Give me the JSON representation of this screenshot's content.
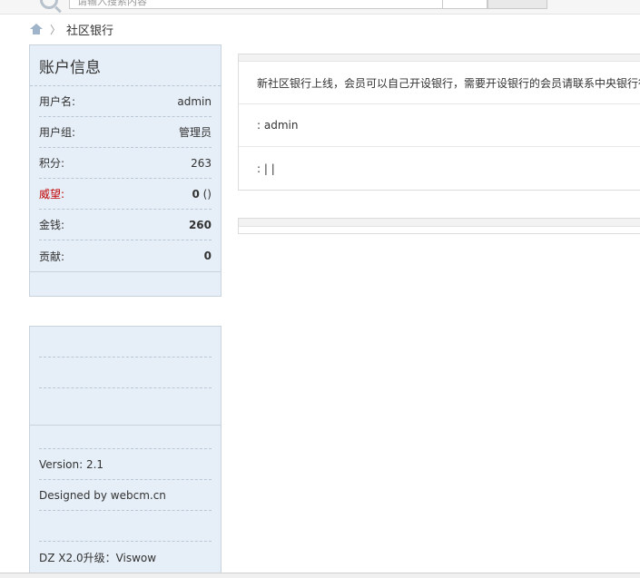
{
  "search": {
    "placeholder": "请输入搜索内容"
  },
  "breadcrumb": {
    "current": "社区银行"
  },
  "sidebar": {
    "title": "账户信息",
    "rows": [
      {
        "label": "用户名:",
        "value": "admin"
      },
      {
        "label": "用户组:",
        "value": "管理员"
      },
      {
        "label": "积分:",
        "value": "263"
      },
      {
        "label": "威望:",
        "value": "0",
        "suffix": " ()"
      },
      {
        "label": "金钱:",
        "value": "260"
      },
      {
        "label": "贡献:",
        "value": "0"
      }
    ],
    "version": "Version: 2.1",
    "designer": "Designed by webcm.cn",
    "upgrade": "DZ X2.0升级：Viswow"
  },
  "main": {
    "notice": "新社区银行上线，会员可以自己开设银行，需要开设银行的会员请联系中央银行行长",
    "user_line": ": admin",
    "links_line": ":  |   |"
  },
  "colors": {
    "sidebar_bg": "#e6eef7",
    "warn_label": "#c00000"
  }
}
